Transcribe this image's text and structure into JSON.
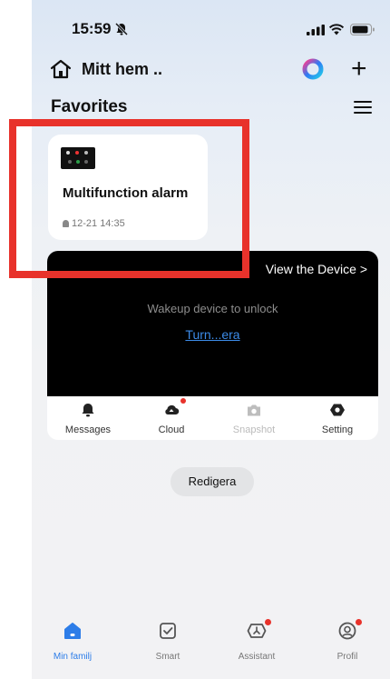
{
  "status_bar": {
    "time": "15:59"
  },
  "header": {
    "home_title": "Mitt hem ..",
    "add_label": "+"
  },
  "favorites": {
    "title": "Favorites"
  },
  "device_card": {
    "name": "Multifunction alarm",
    "time": "12-21 14:35"
  },
  "camera": {
    "view_device": "View the Device >",
    "wakeup_text": "Wakeup device to unlock",
    "turn_link": "Turn...era"
  },
  "actions": [
    {
      "label": "Messages",
      "icon": "bell-icon"
    },
    {
      "label": "Cloud",
      "icon": "cloud-icon"
    },
    {
      "label": "Snapshot",
      "icon": "camera-icon"
    },
    {
      "label": "Setting",
      "icon": "settings-icon"
    }
  ],
  "edit_button": "Redigera",
  "tabs": [
    {
      "label": "Min familj",
      "icon": "home-icon",
      "active": true
    },
    {
      "label": "Smart",
      "icon": "smart-check-icon"
    },
    {
      "label": "Assistant",
      "icon": "assistant-icon"
    },
    {
      "label": "Profil",
      "icon": "profile-icon"
    }
  ],
  "colors": {
    "accent": "#2d7de8",
    "badge": "#e8322b",
    "annotation": "#e8322b"
  }
}
